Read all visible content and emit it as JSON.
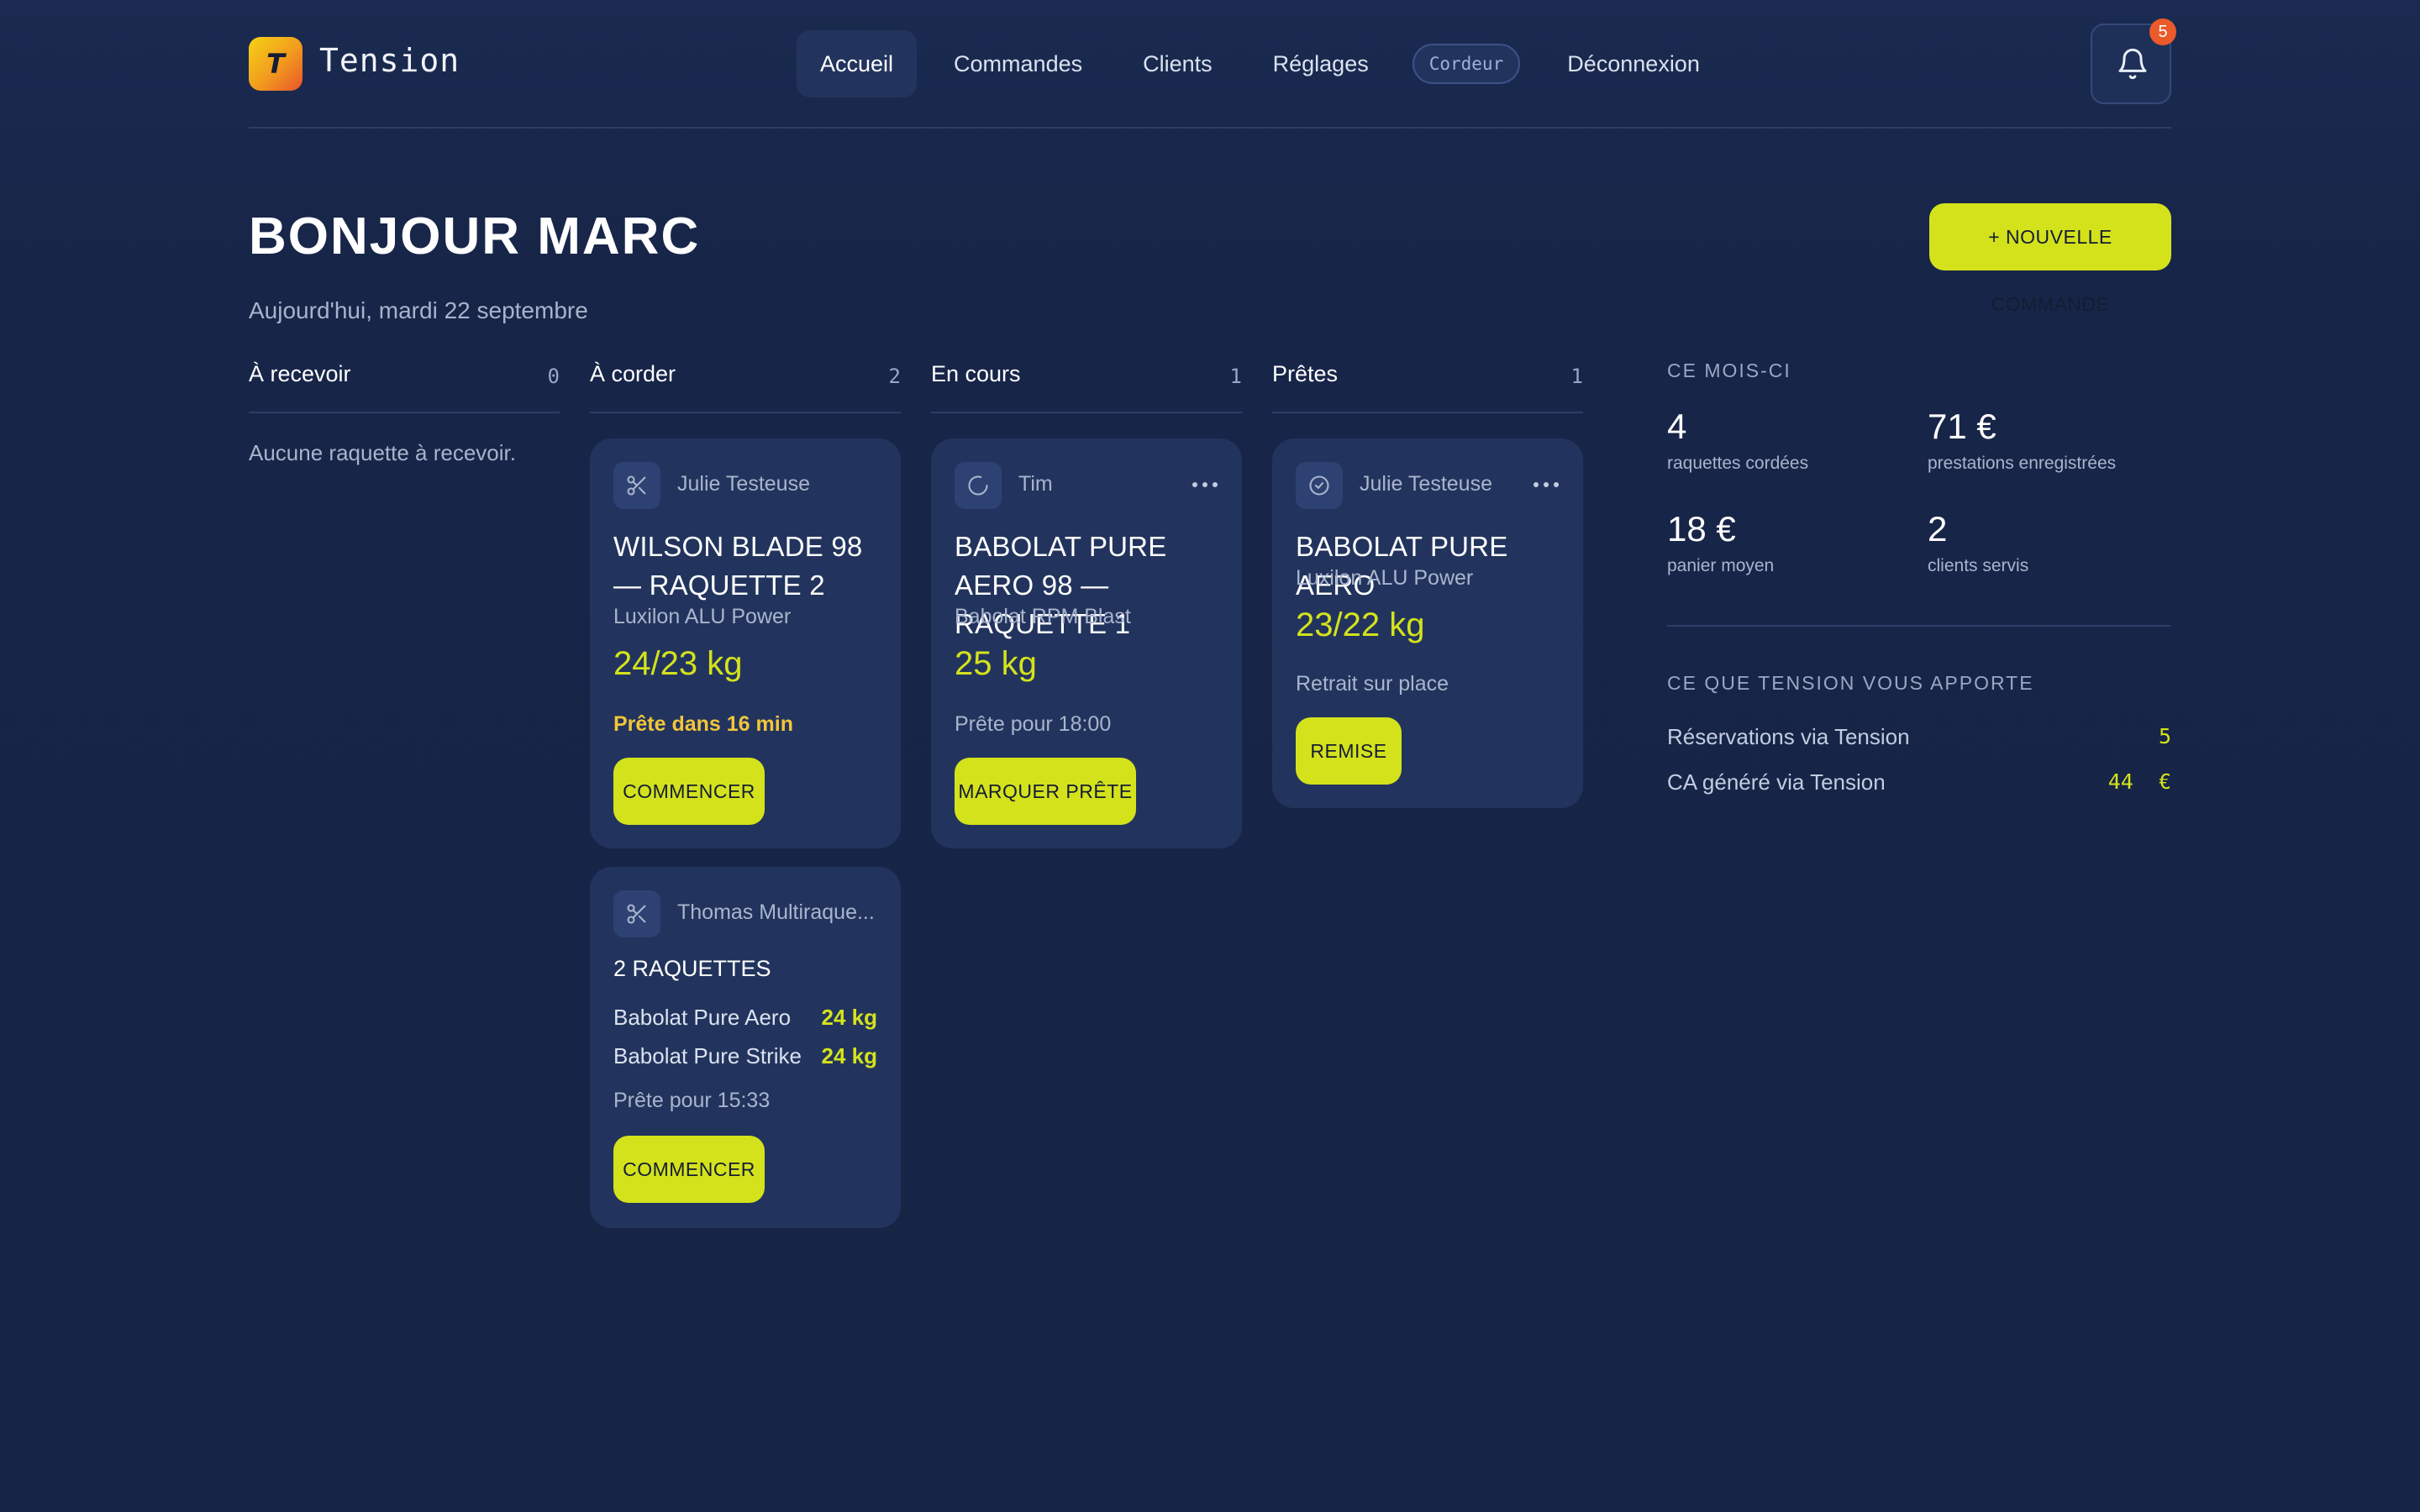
{
  "header": {
    "logo_letter": "T",
    "brand": "Tension",
    "nav": [
      "Accueil",
      "Commandes",
      "Clients",
      "Réglages"
    ],
    "role_badge": "Cordeur",
    "logout": "Déconnexion",
    "notifications_count": "5"
  },
  "greeting": {
    "title": "BONJOUR MARC",
    "date": "Aujourd'hui, mardi 22 septembre",
    "new_order_label": "+ NOUVELLE COMMANDE"
  },
  "columns": [
    {
      "title": "À recevoir",
      "count": "0",
      "empty_text": "Aucune raquette à recevoir."
    },
    {
      "title": "À corder",
      "count": "2"
    },
    {
      "title": "En cours",
      "count": "1"
    },
    {
      "title": "Prêtes",
      "count": "1"
    }
  ],
  "cards": {
    "a_corder_1": {
      "client": "Julie Testeuse",
      "title": "WILSON BLADE 98 — RAQUETTE 2",
      "string": "Luxilon ALU Power",
      "tension": "24/23 kg",
      "status": "Prête dans 16 min",
      "action": "COMMENCER"
    },
    "a_corder_2": {
      "client": "Thomas Multiraque...",
      "title": "2 RAQUETTES",
      "rackets": [
        {
          "name": "Babolat Pure Aero",
          "tension": "24 kg"
        },
        {
          "name": "Babolat Pure Strike",
          "tension": "24 kg"
        }
      ],
      "status": "Prête pour 15:33",
      "action": "COMMENCER"
    },
    "en_cours_1": {
      "client": "Tim",
      "title": "BABOLAT PURE AERO 98 — RAQUETTE 1",
      "string": "Babolat RPM Blast",
      "tension": "25 kg",
      "status": "Prête pour 18:00",
      "action": "MARQUER PRÊTE"
    },
    "pretes_1": {
      "client": "Julie Testeuse",
      "title": "BABOLAT PURE AERO",
      "string": "Luxilon ALU Power",
      "tension": "23/22 kg",
      "status": "Retrait sur place",
      "action": "REMISE"
    }
  },
  "stats": {
    "month_label": "CE MOIS-CI",
    "items": [
      {
        "value": "4",
        "label": "raquettes cordées"
      },
      {
        "value": "71 €",
        "label": "prestations enregistrées"
      },
      {
        "value": "18 €",
        "label": "panier moyen"
      },
      {
        "value": "2",
        "label": "clients servis"
      }
    ],
    "tension_label": "CE QUE TENSION VOUS APPORTE",
    "tension_rows": [
      {
        "label": "Réservations via Tension",
        "value": "5"
      },
      {
        "label": "CA généré via Tension",
        "value": "44  €"
      }
    ]
  },
  "colors": {
    "accent": "#d4e21c",
    "background": "#172548",
    "card": "#22345d",
    "warning": "#f2c53a",
    "badge": "#ea5a2b"
  }
}
